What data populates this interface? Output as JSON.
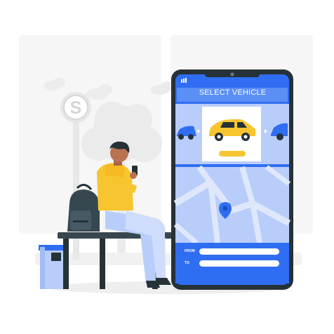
{
  "app": {
    "screen_title": "SELECT VEHICLE"
  },
  "bus_stop": {
    "sign_letter": "S"
  },
  "booking_form": {
    "from_label": "FROM",
    "to_label": "TO"
  },
  "colors": {
    "primary_blue": "#2f6ef2",
    "light_blue": "#dfe8fb",
    "accent_yellow": "#f7c52f",
    "dark": "#263238",
    "background_gray": "#f1f1f1"
  },
  "icons": [
    "signal-icon",
    "camera-icon",
    "car-icon",
    "location-pin-icon",
    "backpack-icon",
    "trash-bin-icon",
    "bus-stop-sign-icon",
    "smartphone-icon"
  ]
}
